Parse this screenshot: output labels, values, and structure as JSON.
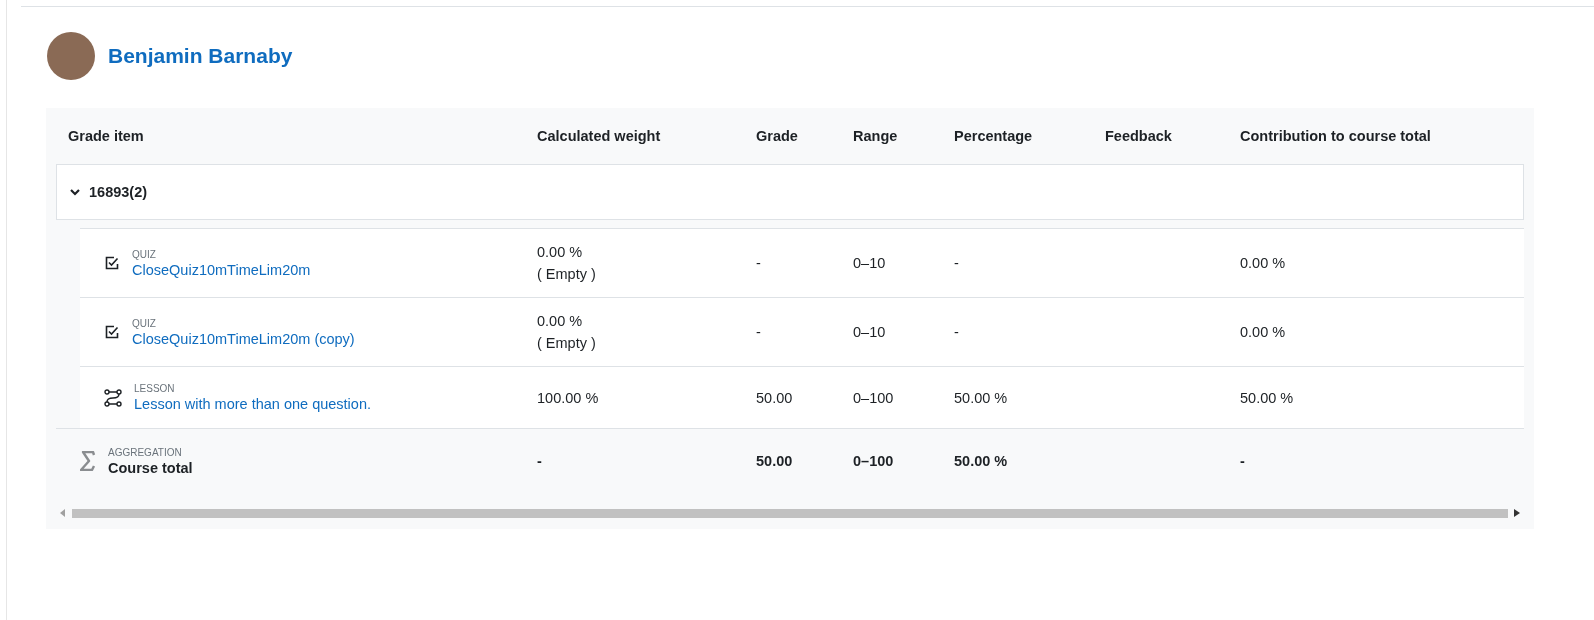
{
  "user": {
    "name": "Benjamin Barnaby"
  },
  "columns": [
    "Grade item",
    "Calculated weight",
    "Grade",
    "Range",
    "Percentage",
    "Feedback",
    "Contribution to course total"
  ],
  "category": {
    "name": "16893(2)",
    "expanded": true
  },
  "items": [
    {
      "kind": "quiz",
      "type": "QUIZ",
      "name": "CloseQuiz10mTimeLim20m",
      "weight": "0.00 %",
      "weight_note": "( Empty )",
      "grade": "-",
      "range": "0–10",
      "percentage": "-",
      "contribution": "0.00 %"
    },
    {
      "kind": "quiz",
      "type": "QUIZ",
      "name": "CloseQuiz10mTimeLim20m (copy)",
      "weight": "0.00 %",
      "weight_note": "( Empty )",
      "grade": "-",
      "range": "0–10",
      "percentage": "-",
      "contribution": "0.00 %"
    },
    {
      "kind": "lesson",
      "type": "LESSON",
      "name": "Lesson with more than one question.",
      "weight": "100.00 %",
      "grade": "50.00",
      "range": "0–100",
      "percentage": "50.00 %",
      "contribution": "50.00 %"
    }
  ],
  "total": {
    "type": "AGGREGATION",
    "name": "Course total",
    "weight": "-",
    "grade": "50.00",
    "range": "0–100",
    "percentage": "50.00 %",
    "contribution": "-"
  }
}
